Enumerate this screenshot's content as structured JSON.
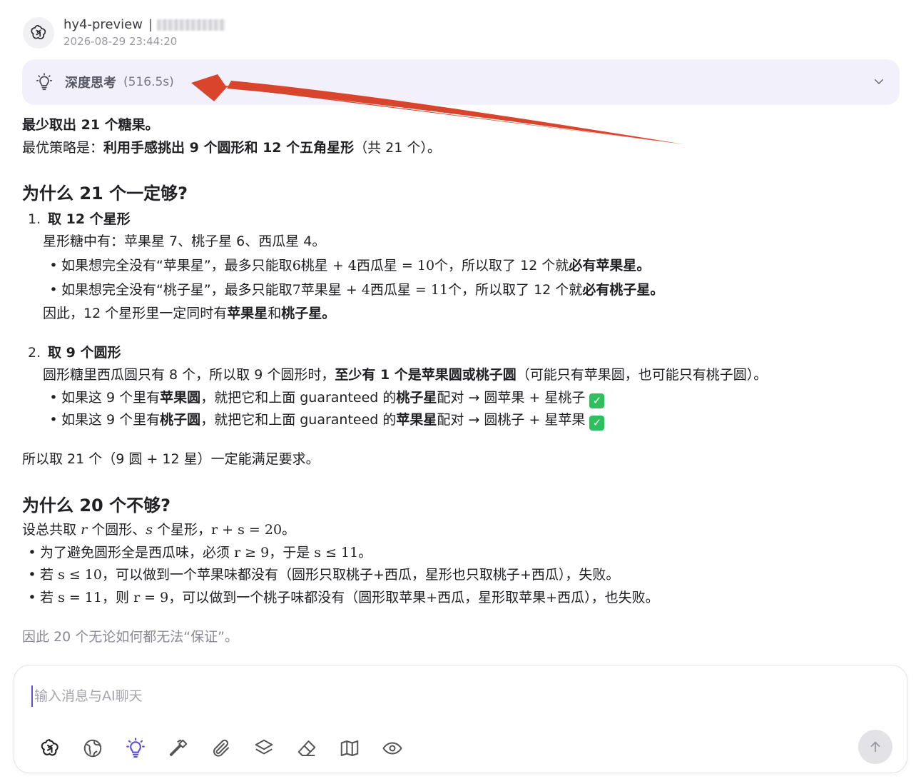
{
  "header": {
    "model": "hy4-preview",
    "separator": "|",
    "timestamp": "2026-08-29 23:44:20"
  },
  "thinking": {
    "label": "深度思考",
    "duration": "(516.5s)"
  },
  "answer": {
    "l1": "最少取出 21 个糖果。",
    "l2a": "最优策略是：",
    "l2b": "利用手感挑出 9 个圆形和 12 个五角星形",
    "l2c": "（共 21 个）。",
    "h1": "为什么 21 个一定够?",
    "s1_num": "1.",
    "s1_title": "取 12 个星形",
    "s1_l1": "星形糖中有：苹果星 7、桃子星 6、西瓜星 4。",
    "s1_b1a": "如果想完全没有“苹果星”，最多只能取",
    "s1_b1m": "6桃星 + 4西瓜星 = 10",
    "s1_b1b": "个，所以取了 12 个就",
    "s1_b1c": "必有苹果星。",
    "s1_b2a": "如果想完全没有“桃子星”，最多只能取",
    "s1_b2m": "7苹果星 + 4西瓜星 = 11",
    "s1_b2b": "个，所以取了 12 个就",
    "s1_b2c": "必有桃子星。",
    "s1_c1": "因此，12 个星形里一定同时有",
    "s1_c2": "苹果星",
    "s1_c3": "和",
    "s1_c4": "桃子星。",
    "s2_num": "2.",
    "s2_title": "取 9 个圆形",
    "s2_l1a": "圆形糖里西瓜圆只有 8 个，所以取 9 个圆形时，",
    "s2_l1b": "至少有 1 个是苹果圆或桃子圆",
    "s2_l1c": "（可能只有苹果圆，也可能只有桃子圆）。",
    "s2_b1a": "如果这 9 个里有",
    "s2_b1b": "苹果圆",
    "s2_b1c": "，就把它和上面 guaranteed 的",
    "s2_b1d": "桃子星",
    "s2_b1e": "配对 → 圆苹果 + 星桃子",
    "s2_b2a": "如果这 9 个里有",
    "s2_b2b": "桃子圆",
    "s2_b2c": "，就把它和上面 guaranteed 的",
    "s2_b2d": "苹果星",
    "s2_b2e": "配对 → 圆桃子 + 星苹果",
    "check": "✓",
    "concl1": "所以取 21 个（9 圆 + 12 星）一定能满足要求。",
    "h2": "为什么 20 个不够?",
    "w_l1a": "设总共取",
    "w_l1b": "r",
    "w_l1c": "个圆形、",
    "w_l1d": "s",
    "w_l1e": "个星形，",
    "w_l1f": "r + s = 20",
    "w_l1g": "。",
    "w_b1a": "为了避免圆形全是西瓜味，必须",
    "w_b1b": "r ≥ 9",
    "w_b1c": "，于是",
    "w_b1d": "s ≤ 11",
    "w_b1e": "。",
    "w_b2a": "若",
    "w_b2b": "s ≤ 10",
    "w_b2c": "，可以做到一个苹果味都没有（圆形只取桃子+西瓜，星形也只取桃子+西瓜），失败。",
    "w_b3a": "若",
    "w_b3b": "s = 11",
    "w_b3c": "，则",
    "w_b3d": "r = 9",
    "w_b3e": "，可以做到一个桃子味都没有（圆形取苹果+西瓜，星形取苹果+西瓜），也失败。",
    "final": "因此 20 个无论如何都无法“保证”。"
  },
  "composer": {
    "placeholder": "输入消息与AI聊天"
  },
  "toolbar": {
    "icons": [
      "model-logo-icon",
      "globe-icon",
      "bulb-icon",
      "hammer-icon",
      "paperclip-icon",
      "layers-icon",
      "eraser-icon",
      "map-icon",
      "eye-icon"
    ]
  },
  "colors": {
    "accent": "#5b4fd6",
    "thinking_bg": "#f2f1fb",
    "arrow": "#d9452c",
    "check": "#2fbf5f"
  }
}
